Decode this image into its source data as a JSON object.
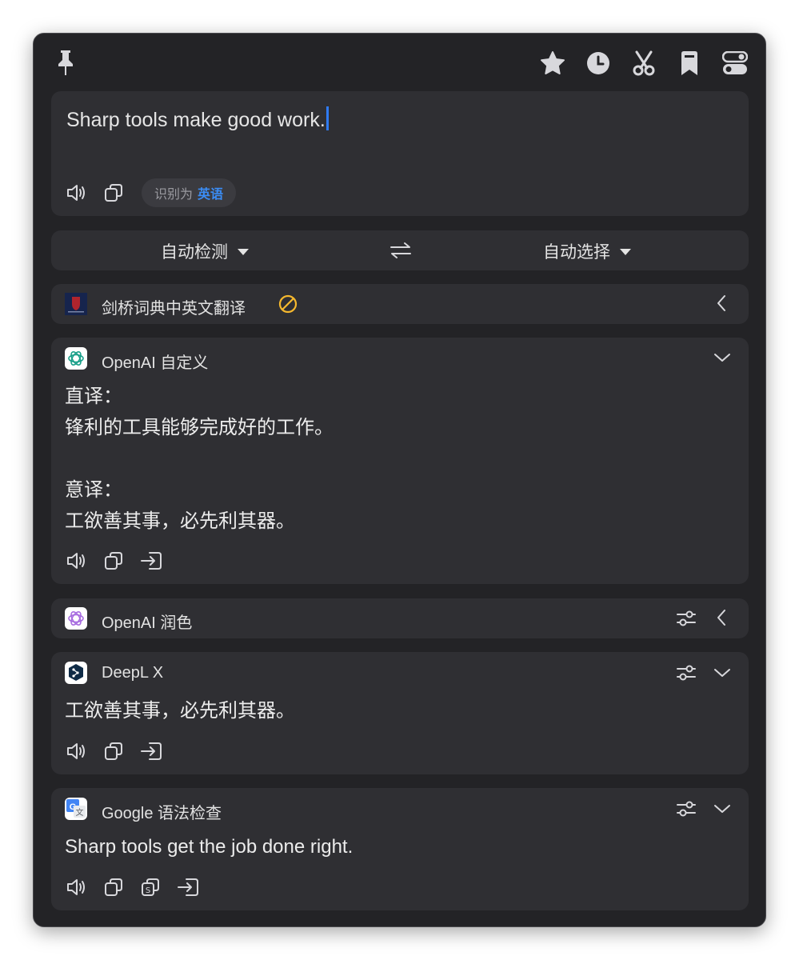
{
  "toolbar": {
    "left_icon": "pin-icon",
    "right_icons": [
      "star-icon",
      "history-clock-icon",
      "scissors-icon",
      "bookmark-icon",
      "toggle-settings-icon"
    ]
  },
  "input": {
    "text": "Sharp tools make good work.",
    "detected_prefix": "识别为",
    "detected_lang": "英语"
  },
  "lang_bar": {
    "source": "自动检测",
    "target": "自动选择",
    "swap_icon": "swap-arrows-icon"
  },
  "services": {
    "cambridge": {
      "name": "剑桥词典中英文翻译",
      "status_icon": "disabled-circle-icon"
    },
    "openai_custom": {
      "name": "OpenAI 自定义",
      "result": "直译：\n锋利的工具能够完成好的工作。\n\n意译：\n工欲善其事，必先利其器。"
    },
    "openai_polish": {
      "name": "OpenAI 润色"
    },
    "deepl": {
      "name": "DeepL X",
      "result": "工欲善其事，必先利其器。"
    },
    "google": {
      "name": "Google 语法检查",
      "result": "Sharp tools get the job done right."
    }
  },
  "colors": {
    "window_bg": "#232326",
    "card_bg": "#2f2f33",
    "accent_blue": "#3b8df5",
    "warning_yellow": "#f5b82e"
  }
}
